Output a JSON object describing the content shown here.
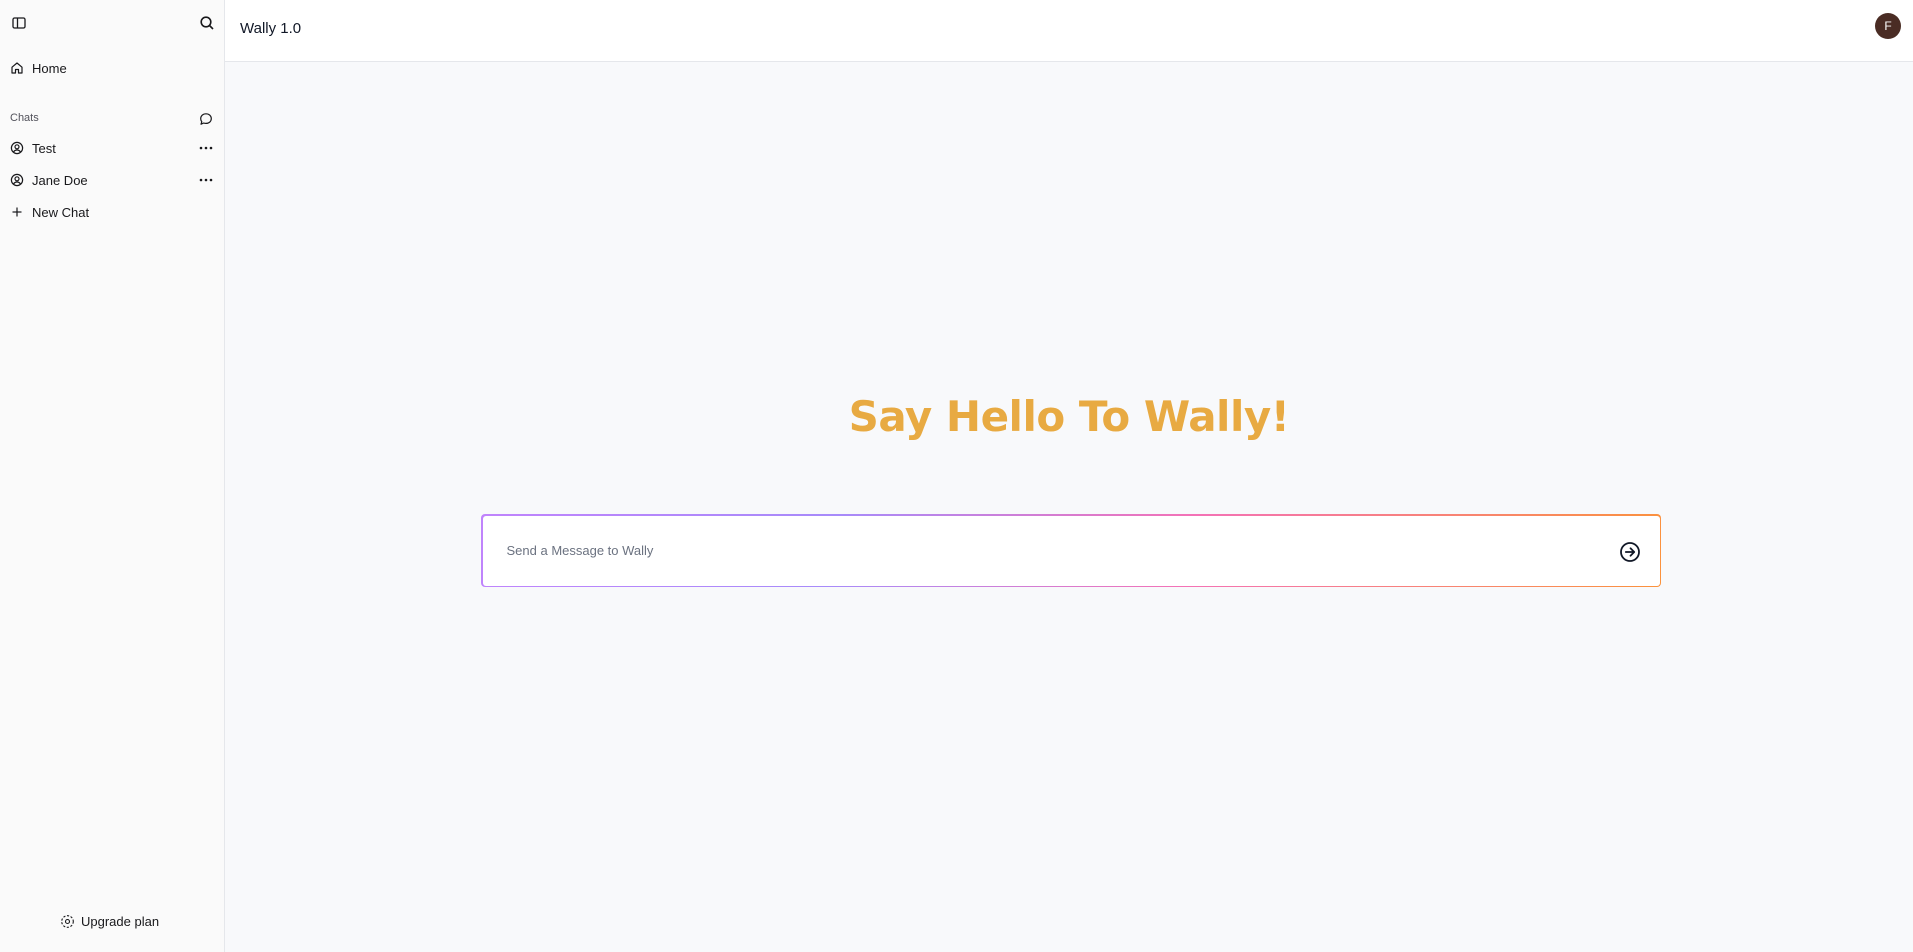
{
  "sidebar": {
    "toggle_icon": "sidebar-toggle-icon",
    "search_icon": "search-icon",
    "home_label": "Home",
    "chats_title": "Chats",
    "chats": [
      {
        "label": "Test"
      },
      {
        "label": "Jane Doe"
      }
    ],
    "new_chat_label": "New Chat",
    "upgrade_label": "Upgrade plan"
  },
  "header": {
    "title": "Wally 1.0",
    "avatar_initial": "F"
  },
  "main": {
    "headline": "Say Hello To Wally!",
    "message_placeholder": "Send a Message to Wally",
    "message_value": ""
  },
  "colors": {
    "accent": "#e8aa42",
    "avatar_bg": "#4a2c24",
    "gradient_start": "#c084fc",
    "gradient_end": "#fb923c"
  }
}
